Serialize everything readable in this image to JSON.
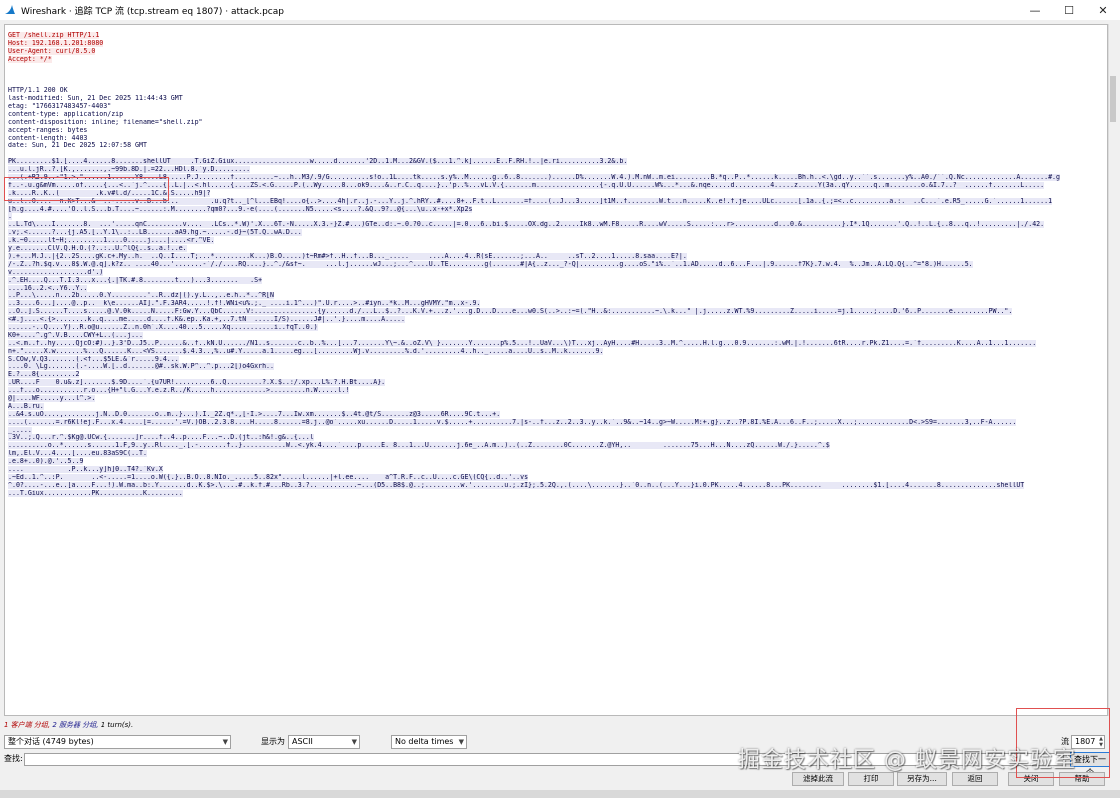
{
  "window": {
    "title": "Wireshark · 追踪 TCP 流 (tcp.stream eq 1807) · attack.pcap",
    "controls": {
      "minimize": "—",
      "maximize": "☐",
      "close": "✕"
    }
  },
  "stream": {
    "client_lines": [
      "GET /shell.zip HTTP/1.1",
      "Host: 192.168.1.201:8080",
      "User-Agent: curl/8.5.0",
      "Accept: */*"
    ],
    "server_header_lines": [
      "HTTP/1.1 200 OK",
      "last-modified: Sun, 21 Dec 2025 11:44:43 GMT",
      "etag: \"1766317483457-4403\"",
      "content-type: application/zip",
      "content-disposition: inline; filename=\"shell.zip\"",
      "accept-ranges: bytes",
      "content-length: 4403",
      "date: Sun, 21 Dec 2025 12:07:58 GMT"
    ],
    "server_body_lines": [
      "PK.........$1.[....4......8.......shellUT     .T.GiZ.Giux...................w.....d.......'2D..1.M...2&GV.($...1.^.k]......E..F.RH.!..|e.ri..........3.2&.b.",
      "...u.l.jR..?.[K.,.......,.~99b.8D.|.=22...HDl.8.`y.D.........",
      "...(.+R2.9..-\"1.>.\"......1......Y8....L8.....P.J........f..........~...h..M3/.9/G..........s!o..1L....tk.....s.y%..M......g..6..8.......)......D%.......W.4.).M.nW..m.ei.........B.*q..P..*......k.....Bh.h..<.\\gd..y..``.s.......y%..A0./``.Q.Nc.............A.......#.g",
      "f..-.u.g&mVm.....of.....{...<..`j.^....{..L.|..<.hl.....{....ZS.<.G.....P.(..Wy.....8...ok9....&..r.C..q....}..'p..%...vL.V.{.......m................{-.q.U.U......W%...*...&.nqe.....d.........4.....z.....Y(3a..qY......q..m........o.&I.7..?  ......f.......L.....",
      ".k....R..K..(         .k.v#l.d/.....1C.&.S.....h9|?",
      "u..l..0....  n.K>T...&  ..-.....v..B...b...        .u.q?t.._[^l...EBq!....o{..>....4h|.r..j.-...Y..j.^.hRY..#....8+..F.t..L.......=f....(..J...3.....]t1M..f........W.t...n.....K..e!.f.je....ULc......[.1a..{.;=<..c.........a.:.  ..C...`.e.R5_.....G.`......1......1",
      "[h.g....4.#....'O..l.S...b.T....~......:.M........?qm0?...9.-e(....(.......N5.....<s....?.&Q..9?..@{...\\u..x-+x*.Xp2s",
      ".",
      "..L.Td\\....I.......8.  ...'.....qnC.........v....  .LCs..*.W)'.X...6T.-N.....X.3.-}Z.#...)GTe..d:.~.0.?0..c.....|=.0...6..bi.$.....OX.dg..2.....Ik8..wM.F8.....R....wV.....S.....:...r>..........d...0.&..........}.I*.1Q.......'.Q..!..L.{..8...q..!.........|./.42.",
      ".v;.<......?...{j.A5.[..Y.1\\..:..LB.......aA9.hg.~.....-.d}~(5T.Q..wA.D...",
      ".k.~0.....lt~H;.........1....0.....j....|....<r.^VE.",
      "y.e.......ClV.Q.H.O.(?..:..U.^lQ{..s..a.!..e.",
      ").+...M.J..|{2..2S....gK.c+.My..h.  ..Q..I....T;...*.........K...)B.O.....)t~Rm#>f..H..f...B..._.....     ....A....4..R(sE.......;...A..     ..sT..2....1.....8.saa....E?|.",
      "/-.Z..?h.$q.v...8$.W.@.q].k?z.. ....40...'.......-`/./....RQ....}..^./&sf~.     ...l.j......wJ...;...^....U..TE.........g(.......#|A{..z..._?-Q|..........g....oS.\"i%..`..1.AD.....d..6...F...|.9......f7K}.7.w.4.  %..Jm..A.LQ.Q{..^=\"8.)H......5.",
      "v...................d'.)",
      ".^.EH....Q...T.I.3...x...{.|TK.#.8........t...)...3.......   .S+",
      "....16..2.<..Y6..Y..",
      "..P...\\.....n...2b.....0.Y.........'..R..dz|().y.L..,..e.h..*..^R[N",
      "..3....6...]....@..p..  k\\e......AI].\".F.3AR4.....!.f!.WNi<u%.;._ ....i.1^...)\".U.r....>..#iyn..*k..M...gHVMY.\"m..x-.9.",
      "..O..].S......T....s.....@.V.0k.....N.....F:Gw.Y...QbC......V:................{y......d./...L..$..?...K.V.+...z.'...g.D...D....e...w0.S(..>..:~=(.\"H..&:...........~.\\.k...\" |.j.....z.WT.%9.........Z.....i.....=j.1.....;....D.'6..P.......e.........PW..\".",
      "<#.j....<.{>........k..q....me.....d....f.K&.ep..Ka.+,..7.tN  .....I/S)......J#|..'.}....m....A.....",
      "......-..Q....Y)..R.o@u......Z..n.0h`.X....40...5.....Xq...........i..fqT..0.)",
      "K0+....^.g^.V.B....CWY+L..(...j...",
      "..<.m..f..hy.....QjcO:#)..}.3'D..J5..P......&..f..kN.U....../N1..s.......c..b..%...[...7.......Y\\~.&..oZ.V\\ }.......Y.......p%.5...!..UaV...\\)T...xj..AyH....#H.....3..M.^.....H.l.g...0.9.......:.wM.|.!.......6tR....r.Pk.Z1....=.`f.........K....A..1...1.......",
      "n+.\".....X.w.......%...Q......K...<VS.......$.4.3..,%..u#.Y.....a.1.....eg...[.........Wj.v.........%.d.'.........4..h.._.....a....U..s..M..k.......9.",
      "S.COw,V.Q3.......(.<f...$5LE.&`r.....9.4...",
      "....0. \\Lg.......(.-....W.[..d.......@#..sk.W.P^..^.p...2[)o4Gxrh..",
      "E.?...8{.........2",
      ".UR....F    0.u&.z].......$.9D....`.{u7UR!.........6..Q.........?.X.$..:/.xp...L%.?.H.Bt....A}.",
      "...f...o...........r.o...{H+\"l.G...Y.e.z.R../K.....h.............>.........n.W.....l.!",
      "@|....WF.....y...l^.>.",
      "A...B.ru.",
      "..&4.s.uO....,........j.N..D.0.......o..m..}...).I._2Z.q*.,[-I.>....7...Iw.xm.......$..4t.@t/S.......z@3.....6R....9C.t...+.",
      "....(.......=.r6Kl!ej.F...x.4.....[=......'.=V.)OB..2.3.8....H.....8......=8.j..@o`.....xu......D.....1.....v.$.....+..........7.|s-..f...z..2..3..y..k.`..9&..~14..g>~W.....M:+.g}..z..?P.8I.%E.A...6..F..;.....X...;.............D<.>S9=.......3,..F-A......",
      "_.....",
      ".3V..;.Q...r.^.$Kg@.UCw.{.......]r....f..4..p....F...~..D.(jt..:h&!.g&..{...l",
      "..........o..*......s......1.F,9..y..Rl...._.[.-.......f..}...........W..<.yk.4....`....p.....E. 8...1...U.......j.6e_..A.m..)..(..Z........0C.......Z.@YH,..        .......75...H...N....zQ......W./.}.....^.$",
      "lm,.El.V...4....[....eu.83aS9C(..T.",
      ".e.8+..0).@.'..5..9",
      "....           .P..k...y]h]0..T4?.`Kv.X",
      ".~Ed..1.^..:P.       ..<-.....=1....o.W({.}..B.O..8.NIo._.....5..82x\".....l......|+l.ee....    a^T.R.F..c..U....c.GE\\(CQ{..d..'..vs",
      "^.0?....-...e..[a....F...!).W.ma..b:.Y.......d..K.$>.\\....#..k.f.#...Rb..3.?.. .........~...(D5..B8$.@..;.........w.'........u.;.zI};.5.2Q.,.(....\\.......}..`0..n..(...Y...}i.0.PK.....4......8...PK........     ........$1.[....4.......8..............shellUT",
      "...T.Giux............PK...........K........."
    ]
  },
  "summary": {
    "client_part": "1 客户端 分组,",
    "server_part": "2 服务器 分组,",
    "turns_part": "1 turn(s)."
  },
  "controls": {
    "conversation_select": "整个对话 (4749 bytes)",
    "show_as_label": "显示为",
    "show_as_select": "ASCII",
    "delta_select": "No delta times",
    "stream_label": "流",
    "stream_value": "1807"
  },
  "find": {
    "label": "查找:",
    "value": "",
    "next_button": "查找下一个"
  },
  "buttons": {
    "filter_out": "滤掉此流",
    "print": "打印",
    "save_as": "另存为...",
    "back": "返回",
    "close": "关闭",
    "help": "帮助"
  },
  "watermark": "掘金技术社区 @ 蚁景网安实验室"
}
